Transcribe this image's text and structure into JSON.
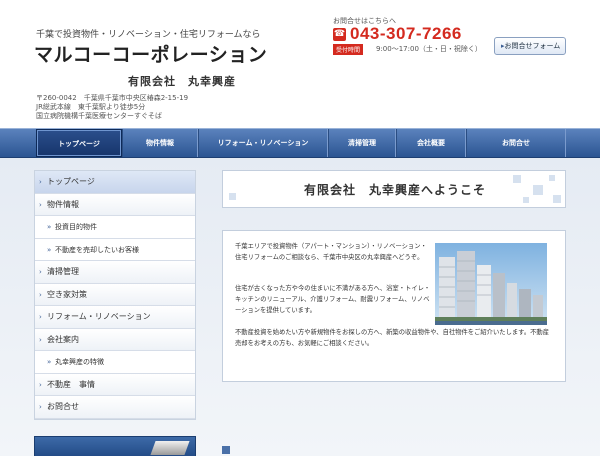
{
  "header": {
    "tagline": "千葉で投資物件・リノベーション・住宅リフォームなら",
    "logo": "マルコーコーポレーション",
    "company": "有限会社　丸幸興産",
    "address_lines": [
      "〒260-0042　千葉県千葉市中央区椿森2-15-19",
      "JR総武本線　東千葉駅より徒歩5分",
      "国立病院機構千葉医療センターすぐそば"
    ],
    "contact_label": "お問合せはこちらへ",
    "phone": "043-307-7266",
    "hours_badge": "受付時間",
    "hours": "9:00〜17:00（土・日・祝除く）",
    "form_button": "お問合せフォーム"
  },
  "nav": {
    "items": [
      "トップページ",
      "物件情報",
      "リフォーム・リノベーション",
      "清掃管理",
      "会社概要",
      "お問合せ"
    ]
  },
  "sidebar": {
    "items": [
      {
        "label": "トップページ",
        "active": true,
        "sub": false
      },
      {
        "label": "物件情報",
        "sub": false
      },
      {
        "label": "投資目的物件",
        "sub": true
      },
      {
        "label": "不動産を売却したいお客様",
        "sub": true
      },
      {
        "label": "清掃管理",
        "sub": false
      },
      {
        "label": "空き家対策",
        "sub": false
      },
      {
        "label": "リフォーム・リノベーション",
        "sub": false
      },
      {
        "label": "会社案内",
        "sub": false
      },
      {
        "label": "丸幸興産の特徴",
        "sub": true
      },
      {
        "label": "不動産　事情",
        "sub": false
      },
      {
        "label": "お問合せ",
        "sub": false
      }
    ]
  },
  "main": {
    "welcome_title": "有限会社　丸幸興産へようこそ",
    "para1": "千葉エリアで投資物件（アパート・マンション）・リノベーション・住宅リフォームのご相談なら、千葉市中央区の丸幸興産へどうぞ。",
    "para2": "住宅が古くなった方や今の住まいに不満がある方へ、浴室・トイレ・キッチンのリニューアル、介護リフォーム、耐震リフォーム、リノベーションを提供しています。",
    "para3": "不動産投資を始めたい方や新規物件をお探しの方へ、新築の収益物件や、自社物件をご紹介いたします。不動産売却をお考えの方も、お気軽にご相談ください。"
  },
  "colors": {
    "accent_red": "#d42a1f",
    "nav_blue": "#3a64a3"
  }
}
